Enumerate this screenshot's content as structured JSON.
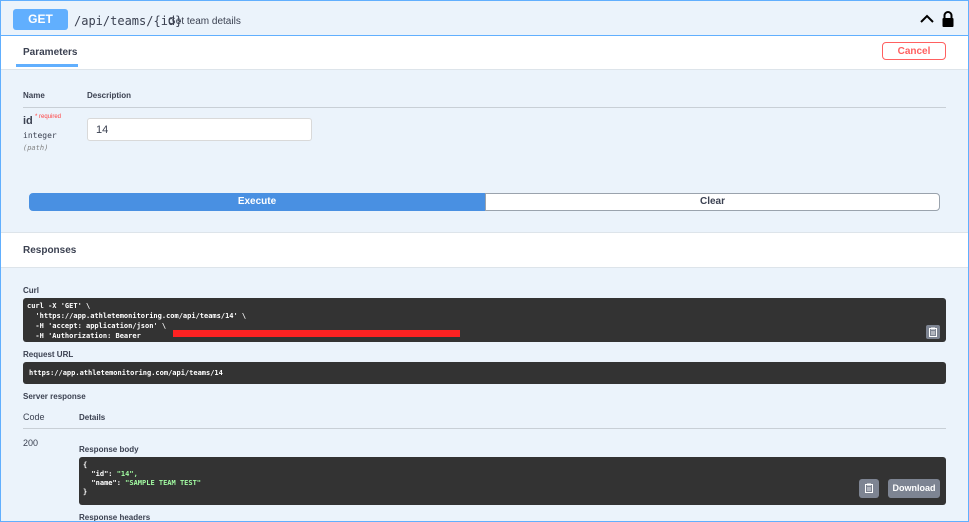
{
  "operation": {
    "method": "GET",
    "path": "/api/teams/{id}",
    "summary": "Get team details"
  },
  "parameters": {
    "tab_label": "Parameters",
    "cancel_label": "Cancel",
    "col_name": "Name",
    "col_description": "Description",
    "items": [
      {
        "name": "id",
        "required_label": "* required",
        "type": "integer",
        "in": "(path)",
        "value": "14"
      }
    ]
  },
  "actions": {
    "execute_label": "Execute",
    "clear_label": "Clear"
  },
  "responses": {
    "title": "Responses",
    "curl_label": "Curl",
    "curl_lines": [
      "curl -X 'GET' \\",
      "  'https://app.athletemonitoring.com/api/teams/14' \\",
      "  -H 'accept: application/json' \\",
      "  -H 'Authorization: Bearer "
    ],
    "request_url_label": "Request URL",
    "request_url": "https://app.athletemonitoring.com/api/teams/14",
    "server_response_label": "Server response",
    "col_code": "Code",
    "col_details": "Details",
    "status_code": "200",
    "response_body_label": "Response body",
    "body": {
      "open": "{",
      "id_key": "  \"id\": ",
      "id_value": "\"14\",",
      "name_key": "  \"name\": ",
      "name_value": "\"SAMPLE TEAM TEST\"",
      "close": "}"
    },
    "download_label": "Download",
    "response_headers_label": "Response headers"
  },
  "colors": {
    "get": "#61affe",
    "execute": "#4990e2",
    "cancel": "#ff6060",
    "code_bg": "#333333"
  }
}
